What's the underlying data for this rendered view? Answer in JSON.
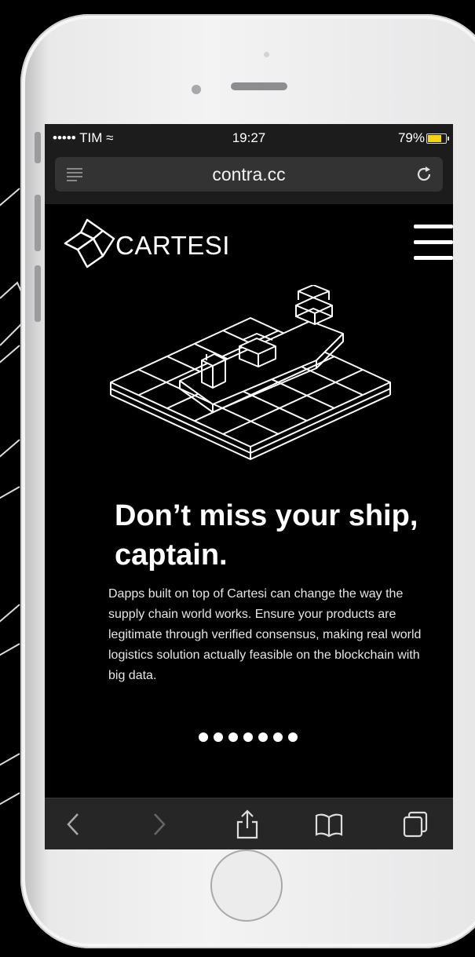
{
  "status_bar": {
    "carrier": "••••• TIM ≈",
    "time": "19:27",
    "battery": "79%",
    "battery_level": 0.79
  },
  "browser": {
    "url": "contra.cc",
    "icons": [
      "reader-icon",
      "reload-icon"
    ]
  },
  "site": {
    "logo_text": "CARTESI",
    "menu_icon": "hamburger-menu-icon",
    "hero_icon": "isometric-cargo-ship-icon",
    "headline": "Don’t miss your ship, captain.",
    "body": "Dapps built on top of Cartesi can change the way the supply chain world works. Ensure your products are legitimate through verified consensus, making real world logistics solution actually feasible on the blockchain with big data.",
    "carousel_dots": 7
  },
  "toolbar": {
    "icons": [
      "back-icon",
      "forward-icon",
      "share-icon",
      "bookmarks-icon",
      "tabs-icon"
    ]
  },
  "colors": {
    "background": "#000000",
    "phone_body": "#e9e9ea",
    "browser_chrome": "#1c1c1c",
    "battery_fill": "#f5d416"
  }
}
